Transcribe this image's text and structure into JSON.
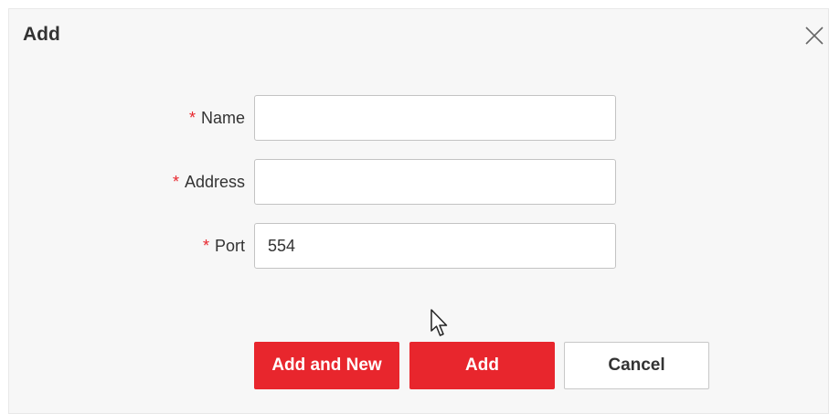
{
  "dialog": {
    "title": "Add",
    "close_icon": "close-icon"
  },
  "form": {
    "name": {
      "required_mark": "*",
      "label": "Name",
      "value": ""
    },
    "address": {
      "required_mark": "*",
      "label": "Address",
      "value": ""
    },
    "port": {
      "required_mark": "*",
      "label": "Port",
      "value": "554"
    }
  },
  "buttons": {
    "add_and_new": "Add and New",
    "add": "Add",
    "cancel": "Cancel"
  },
  "colors": {
    "accent": "#e8262d",
    "dialog_bg": "#f7f7f7",
    "text": "#333333"
  }
}
